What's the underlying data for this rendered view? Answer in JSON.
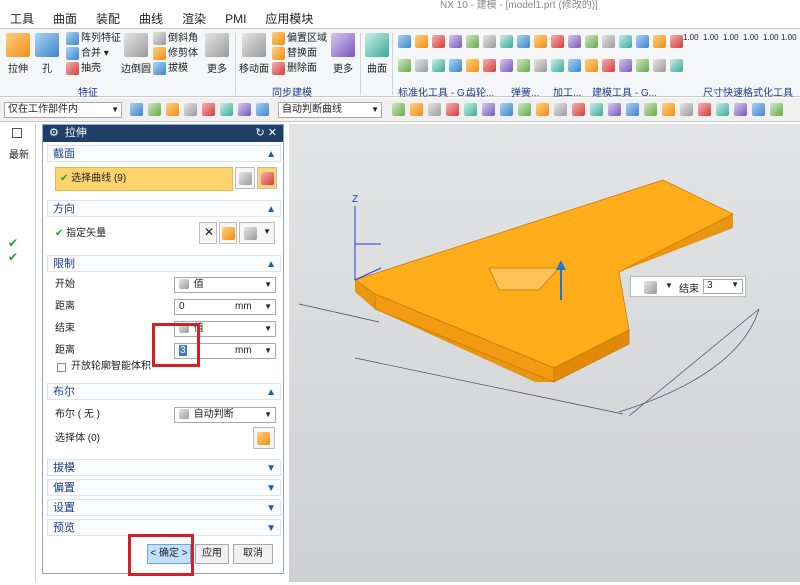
{
  "window": {
    "title": "NX 10 - 建模 - [model1.prt (修改的)]"
  },
  "menu": [
    "工具",
    "曲面",
    "装配",
    "曲线",
    "渲染",
    "PMI",
    "应用模块"
  ],
  "ribbon": {
    "big": [
      "拉伸",
      "孔",
      "边倒圆",
      "更多",
      "移动面",
      "更多",
      "曲面"
    ],
    "small": [
      "阵列特征",
      "合并",
      "抽壳",
      "倒斜角",
      "修剪体",
      "拔模",
      "偏置区域",
      "替换面",
      "删除面"
    ],
    "groups": [
      "特征",
      "同步建模",
      "标准化工具 - G...",
      "齿轮...",
      "弹簧...",
      "加工...",
      "建模工具 - G...",
      "尺寸快速格式化工具"
    ],
    "dims": [
      "1.00",
      "1.00",
      "1.00",
      "1.00",
      "1.00",
      "1.00"
    ]
  },
  "toolbar": {
    "filter": "仅在工作部件内",
    "curve_rule": "自动判断曲线"
  },
  "left_strip": {
    "label": "最新"
  },
  "dialog": {
    "title": "拉伸",
    "sections": {
      "section": {
        "title": "截面",
        "select": "选择曲线 (9)"
      },
      "direction": {
        "title": "方向",
        "vector": "指定矢量"
      },
      "limits": {
        "title": "限制",
        "start_label": "开始",
        "start_value": "值",
        "dist1_label": "距离",
        "dist1_value": "0",
        "unit1": "mm",
        "end_label": "结束",
        "end_value": "值",
        "dist2_label": "距离",
        "dist2_value": "3",
        "unit2": "mm",
        "open_profile": "开放轮廓智能体积"
      },
      "boolean": {
        "title": "布尔",
        "bool_label": "布尔 ( 无 )",
        "bool_value": "自动判断",
        "select_body": "选择体 (0)"
      },
      "draft": "拔模",
      "offset": "偏置",
      "settings": "设置",
      "preview": "预览"
    },
    "buttons": {
      "ok": "< 确定 >",
      "apply": "应用",
      "cancel": "取消"
    }
  },
  "viewport": {
    "z_label": "Z",
    "mini_label": "结束",
    "mini_value": "3",
    "model_color": "#ffad1a"
  }
}
